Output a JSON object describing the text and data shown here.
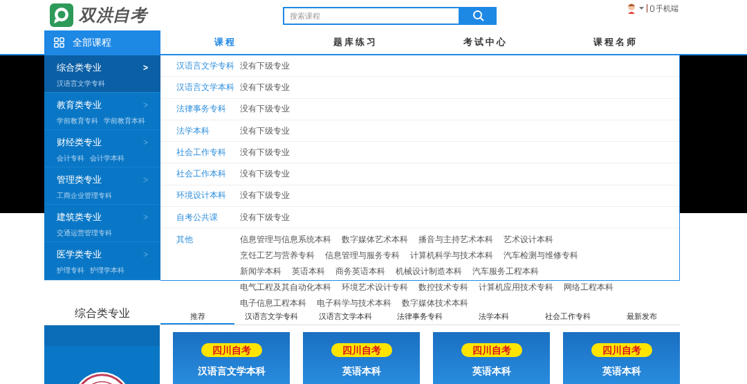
{
  "header": {
    "logo_text": "双洪自考",
    "search": {
      "placeholder": "搜索课程"
    },
    "mobile_link": "手机端"
  },
  "nav": {
    "all_courses": "全部课程",
    "items": [
      {
        "label": "课程",
        "selected": true
      },
      {
        "label": "题库练习",
        "selected": false
      },
      {
        "label": "考试中心",
        "selected": false
      },
      {
        "label": "课程名师",
        "selected": false
      }
    ]
  },
  "sidebar": {
    "categories": [
      {
        "title": "综合类专业",
        "selected": true,
        "arrow": ">",
        "subs": [
          "汉语言文学专科"
        ]
      },
      {
        "title": "教育类专业",
        "selected": false,
        "arrow": ">",
        "subs": [
          "学前教育专科",
          "学前教育本科"
        ]
      },
      {
        "title": "财经类专业",
        "selected": false,
        "arrow": ">",
        "subs": [
          "会计专科",
          "会计学本科"
        ]
      },
      {
        "title": "管理类专业",
        "selected": false,
        "arrow": ">",
        "subs": [
          "工商企业管理专科"
        ]
      },
      {
        "title": "建筑类专业",
        "selected": false,
        "arrow": ">",
        "subs": [
          "交通运营管理专科"
        ]
      },
      {
        "title": "医学类专业",
        "selected": false,
        "arrow": ">",
        "subs": [
          "护理专科",
          "护理学本科"
        ]
      }
    ]
  },
  "dropdown": {
    "rows": [
      {
        "name": "汉语言文学专科",
        "lines": [
          [
            "没有下级专业"
          ]
        ]
      },
      {
        "name": "汉语言文学本科",
        "lines": [
          [
            "没有下级专业"
          ]
        ]
      },
      {
        "name": "法律事务专科",
        "lines": [
          [
            "没有下级专业"
          ]
        ]
      },
      {
        "name": "法学本科",
        "lines": [
          [
            "没有下级专业"
          ]
        ]
      },
      {
        "name": "社会工作专科",
        "lines": [
          [
            "没有下级专业"
          ]
        ]
      },
      {
        "name": "社会工作本科",
        "lines": [
          [
            "没有下级专业"
          ]
        ]
      },
      {
        "name": "环境设计本科",
        "lines": [
          [
            "没有下级专业"
          ]
        ]
      },
      {
        "name": "自考公共课",
        "lines": [
          [
            "没有下级专业"
          ]
        ]
      },
      {
        "name": "其他",
        "lines": [
          [
            "信息管理与信息系统本科",
            "数字媒体艺术本科",
            "播音与主持艺术本科",
            "艺术设计本科"
          ],
          [
            "烹饪工艺与营养专科",
            "信息管理与服务专科",
            "计算机科学与技术本科",
            "汽车检测与维修专科"
          ],
          [
            "新闻学本科",
            "英语本科",
            "商务英语本科",
            "机械设计制造本科",
            "汽车服务工程本科"
          ],
          [
            "电气工程及其自动化本科",
            "环境艺术设计专科",
            "数控技术专科",
            "计算机应用技术专科",
            "网络工程本科"
          ],
          [
            "电子信息工程本科",
            "电子科学与技术本科",
            "数字媒体技术本科"
          ]
        ]
      }
    ]
  },
  "section": {
    "title": "综合类专业",
    "tabs": [
      {
        "label": "推荐",
        "selected": true
      },
      {
        "label": "汉语言文学专科",
        "selected": false
      },
      {
        "label": "汉语言文学本科",
        "selected": false
      },
      {
        "label": "法律事务专科",
        "selected": false
      },
      {
        "label": "法学本科",
        "selected": false
      },
      {
        "label": "社会工作专科",
        "selected": false
      },
      {
        "label": "最新发布",
        "selected": false
      }
    ],
    "cards": [
      {
        "badge": "四川自考",
        "title": "汉语言文学本科"
      },
      {
        "badge": "四川自考",
        "title": "英语本科"
      },
      {
        "badge": "四川自考",
        "title": "英语本科"
      },
      {
        "badge": "四川自考",
        "title": "英语本科"
      }
    ]
  }
}
